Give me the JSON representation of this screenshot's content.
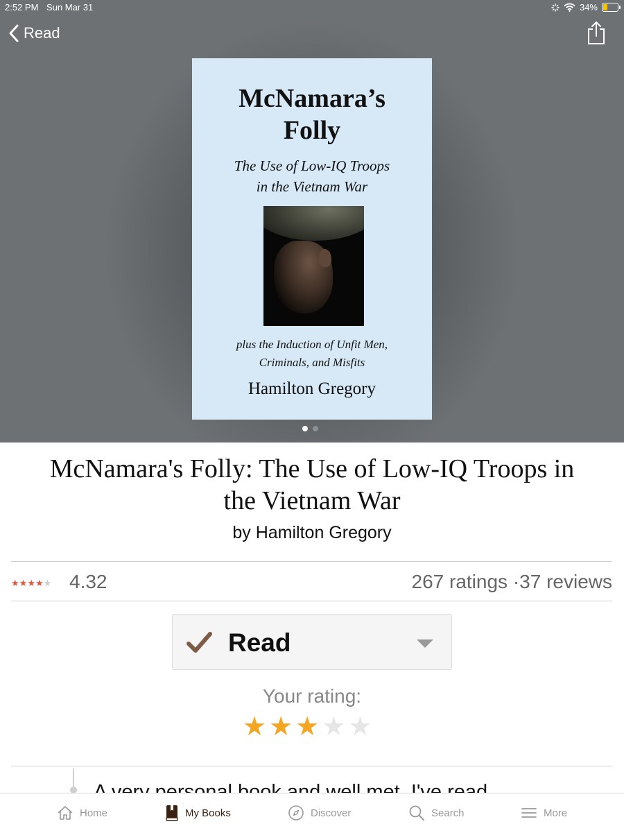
{
  "status_bar": {
    "time": "2:52 PM",
    "date": "Sun Mar 31",
    "battery": "34%",
    "battery_level": 0.34
  },
  "nav": {
    "back_label": "Read"
  },
  "cover": {
    "title_line1": "McNamara’s",
    "title_line2": "Folly",
    "subtitle_line1": "The Use of Low-IQ Troops",
    "subtitle_line2": "in the Vietnam War",
    "tagline_line1": "plus the Induction of Unfit Men,",
    "tagline_line2": "Criminals, and Misfits",
    "author": "Hamilton Gregory",
    "page_count": 2,
    "current_page": 1
  },
  "book": {
    "title_line1": "McNamara's Folly: The Use of Low-IQ Troops in",
    "title_line2": "the Vietnam War",
    "author_line": "by Hamilton Gregory",
    "average_rating": "4.32",
    "average_stars": 4.32,
    "ratings_count": "267 ratings",
    "separator": "·",
    "reviews_count": "37 reviews"
  },
  "shelf": {
    "label": "Read",
    "accent": "#7d5b45"
  },
  "your_rating": {
    "label": "Your rating:",
    "stars": 3,
    "max": 5
  },
  "review": {
    "text_plain": "A ",
    "text_underlined": "very personal b",
    "text_rest": "ook and well met. I've read"
  },
  "tabs": [
    {
      "label": "Home",
      "icon": "home-icon"
    },
    {
      "label": "My Books",
      "icon": "book-icon"
    },
    {
      "label": "Discover",
      "icon": "compass-icon"
    },
    {
      "label": "Search",
      "icon": "search-icon"
    },
    {
      "label": "More",
      "icon": "menu-icon"
    }
  ],
  "colors": {
    "hero_bg": "#6e7174",
    "cover_bg": "#d7e8f7",
    "star_gold": "#f4a622",
    "star_red": "#e0563d",
    "active_tab": "#382110"
  }
}
